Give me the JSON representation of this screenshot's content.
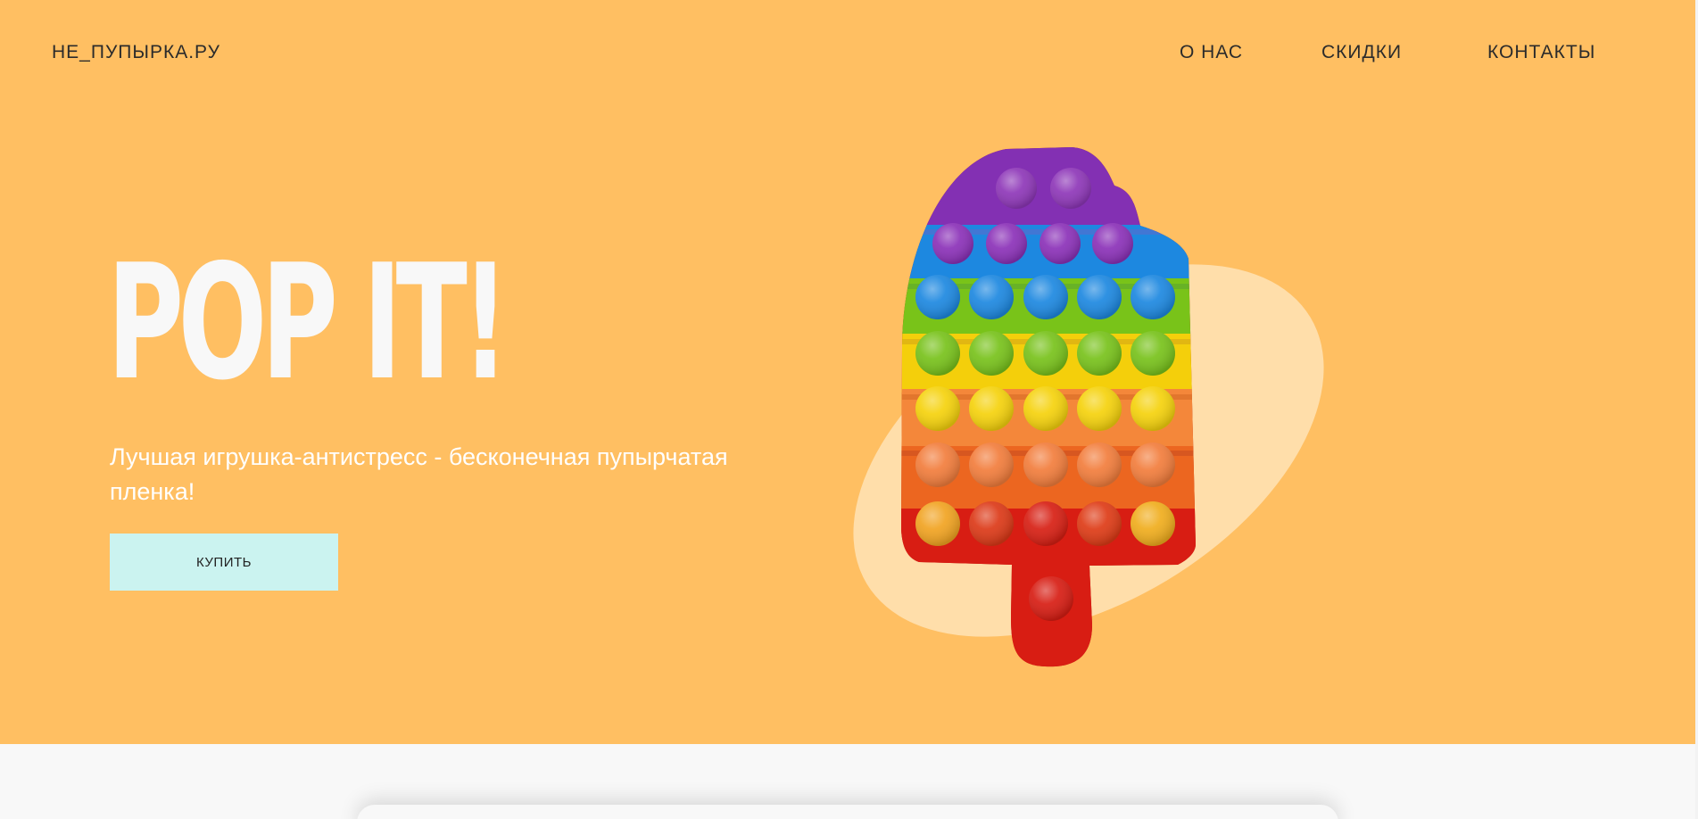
{
  "header": {
    "logo": "НЕ_ПУПЫРКА.РУ",
    "nav": {
      "about": "О НАС",
      "discounts": "СКИДКИ",
      "contacts": "КОНТАКТЫ"
    }
  },
  "hero": {
    "title": "POP IT!",
    "subtitle": "Лучшая игрушка-антистресс - бесконечная пупырчатая пленка!",
    "buy_label": "КУПИТЬ",
    "product_image": "rainbow-popsicle-pop-it-toy",
    "colors": {
      "background": "#ffbf62",
      "title": "#f8f8f8",
      "button": "#cbf3f0",
      "blob": "#ffdeaa"
    }
  }
}
